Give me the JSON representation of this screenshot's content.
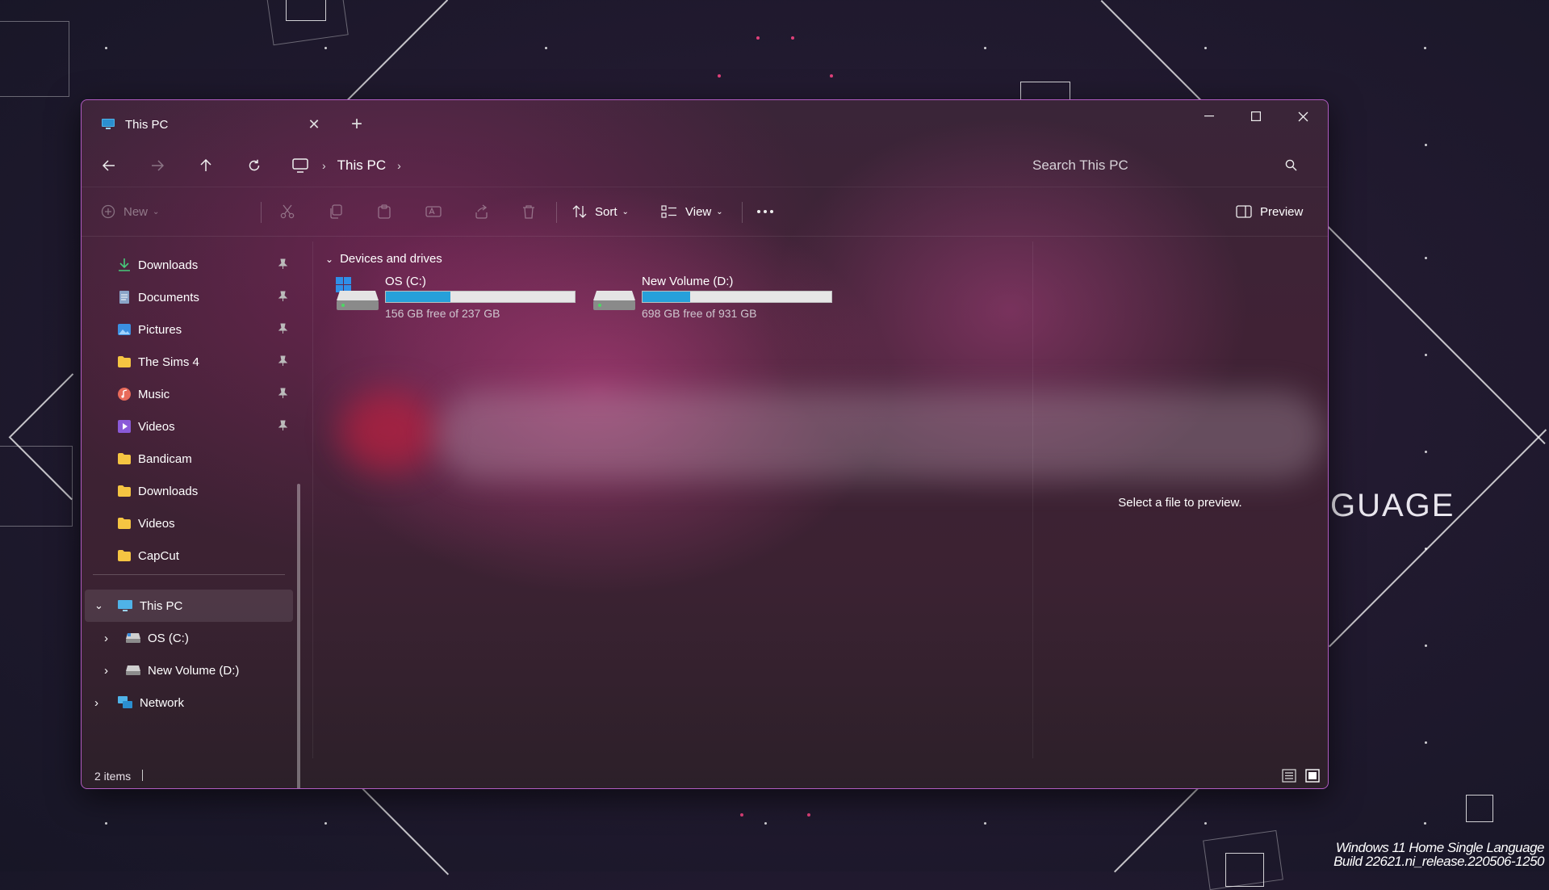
{
  "wallpaper": {
    "word": "GUAGE",
    "watermark_line1": "Windows 11 Home Single Language",
    "watermark_line2": "Build 22621.ni_release.220506-1250"
  },
  "window": {
    "tab_title": "This PC",
    "tab_close_icon": "close-icon",
    "new_tab_icon": "plus-icon",
    "controls": [
      "minimize",
      "maximize",
      "close"
    ]
  },
  "nav": {
    "buttons": [
      "back",
      "forward",
      "up",
      "refresh"
    ],
    "breadcrumb": [
      "This PC"
    ],
    "search_placeholder": "Search This PC"
  },
  "toolbar": {
    "new_label": "New",
    "sort_label": "Sort",
    "view_label": "View",
    "preview_label": "Preview",
    "disabled_actions": [
      "cut",
      "copy",
      "paste",
      "rename",
      "share",
      "delete"
    ]
  },
  "sidebar": {
    "quick_access": [
      {
        "label": "Downloads",
        "icon": "download-icon",
        "pinned": true
      },
      {
        "label": "Documents",
        "icon": "documents-icon",
        "pinned": true
      },
      {
        "label": "Pictures",
        "icon": "pictures-icon",
        "pinned": true
      },
      {
        "label": "The Sims 4",
        "icon": "folder-icon",
        "pinned": true
      },
      {
        "label": "Music",
        "icon": "music-icon",
        "pinned": true
      },
      {
        "label": "Videos",
        "icon": "videos-icon",
        "pinned": true
      },
      {
        "label": "Bandicam",
        "icon": "folder-icon",
        "pinned": false
      },
      {
        "label": "Downloads",
        "icon": "folder-icon",
        "pinned": false
      },
      {
        "label": "Videos",
        "icon": "folder-icon",
        "pinned": false
      },
      {
        "label": "CapCut",
        "icon": "folder-icon",
        "pinned": false
      }
    ],
    "tree": [
      {
        "label": "This PC",
        "icon": "computer-icon",
        "expanded": true,
        "selected": true
      },
      {
        "label": "OS (C:)",
        "icon": "drive-icon",
        "expanded": false
      },
      {
        "label": "New Volume (D:)",
        "icon": "drive-icon",
        "expanded": false
      },
      {
        "label": "Network",
        "icon": "network-icon",
        "expanded": false
      }
    ]
  },
  "content": {
    "group_header": "Devices and drives",
    "drives": [
      {
        "name": "OS (C:)",
        "free_text": "156 GB free of 237 GB",
        "used_fraction": 0.34
      },
      {
        "name": "New Volume (D:)",
        "free_text": "698 GB free of 931 GB",
        "used_fraction": 0.25
      }
    ]
  },
  "preview": {
    "message": "Select a file to preview."
  },
  "status": {
    "items_text": "2 items"
  },
  "colors": {
    "accent": "#26a0da",
    "window_border": "#b05bc0",
    "folder": "#f5c542"
  }
}
